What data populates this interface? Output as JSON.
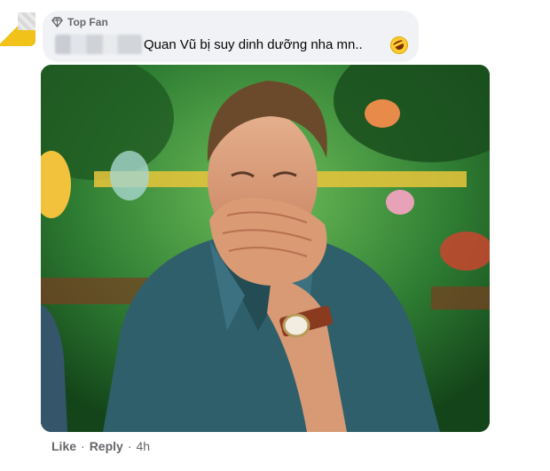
{
  "comment": {
    "badge_label": "Top Fan",
    "badge_icon": "diamond-icon",
    "text": "Quan Vũ bị suy dinh dưỡng nha mn..",
    "emoji": "rolling-on-floor-laughing-emoji"
  },
  "actions": {
    "like_label": "Like",
    "reply_label": "Reply",
    "separator": "·",
    "time": "4h"
  },
  "colors": {
    "bubble_bg": "#f0f2f5",
    "meta_text": "#65676b",
    "shirt": "#2f5f6a",
    "foliage": "#2e7d32"
  }
}
